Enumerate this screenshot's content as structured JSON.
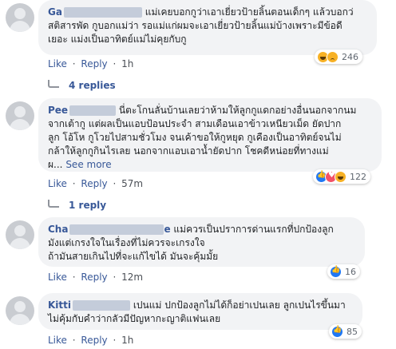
{
  "comments": [
    {
      "name_visible": "Ga",
      "text_lines": [
        "แม่เคยบอกกูว่าเอาเยี่ยวป้ายลิ้นตอนเด็กๆ แล้วบอกว่",
        "สติสารพัด กูบอกแม่ว่า รอแม่แก่ผมจะเอาเยี่ยวป้ายลิ้นแม่บ้างเพราะมีข้อดี",
        "เยอะ แม่งเป็นอาทิตย์แม่ไม่คุยกับกู"
      ],
      "like_label": "Like",
      "reply_label": "Reply",
      "time": "1h",
      "reaction_count": "246",
      "replies_label": "4 replies"
    },
    {
      "name_visible": "Pee",
      "text_lines": [
        "นี่ตะโกนลั่นบ้านเลยว่าห้ามให้ลูกกูแดกอย่างอื่นนอกจากนม",
        "จากเต้ากู แต่ผลเป็นแอบป้อนประจำ สามเดือนเอาข้าวเหนียวเม็ด ยัดปาก",
        "ลูก โอ้โห กูโวยไปสามชั่วโมง จนเค้าขอให้กูหยุด กูเคืองเป็นอาทิตย์จนไม่",
        "กล้าให้ลูกกูกินไรเลย นอกจากแอบเอาน้ำยัดปาก โชคดีหน่อยที่ทางแม่"
      ],
      "last_line": "ผ...",
      "see_more": "See more",
      "like_label": "Like",
      "reply_label": "Reply",
      "time": "57m",
      "reaction_count": "122",
      "replies_label": "1 reply"
    },
    {
      "name_visible": "Cha",
      "name_tail": "e",
      "text_first": "แม่ควรเป็นปราการด่านแรกที่ปกป้องลูก",
      "text_lines": [
        "มังแต่เกรงใจในเรื่องที่ไม่ควรจะเกรงใจ",
        "ถ้ามันสายเกินไปที่จะแก้ไขได้ มันจะคุ้มมั้ย"
      ],
      "like_label": "Like",
      "reply_label": "Reply",
      "time": "12m",
      "reaction_count": "16"
    },
    {
      "name_visible": "Kitti",
      "text_first": "เปนแม่ ปกป้องลูกไม่ได้ก็อย่าเปนเลย ลูกเปนไรขึ้นมา",
      "text_lines": [
        "ไม่คุ้มกับคำว่ากลัวมีปัญหากะญาติแฟนเลย"
      ],
      "like_label": "Like",
      "reply_label": "Reply",
      "time": "1h",
      "reaction_count": "85"
    }
  ]
}
